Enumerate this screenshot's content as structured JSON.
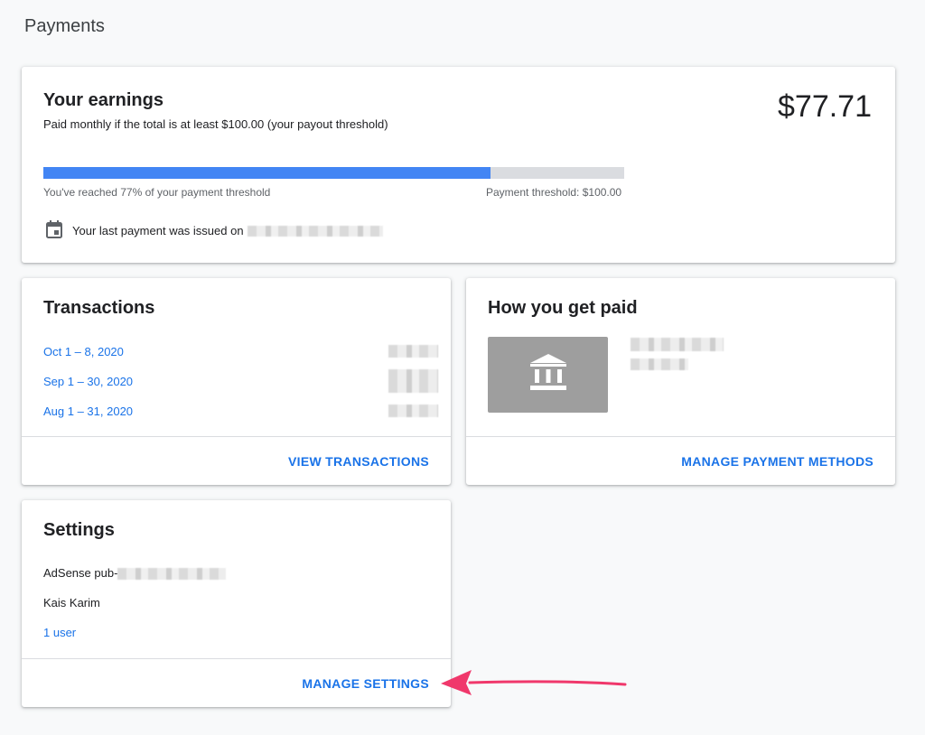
{
  "page": {
    "title": "Payments"
  },
  "earnings": {
    "title": "Your earnings",
    "subtitle": "Paid monthly if the total is at least $100.00 (your payout threshold)",
    "amount": "$77.71",
    "progress_fraction": 0.77,
    "progress_label": "You've reached 77% of your payment threshold",
    "threshold_label": "Payment threshold: $100.00",
    "last_payment_label": "Your last payment was issued on",
    "calendar_icon": "calendar-icon"
  },
  "transactions": {
    "title": "Transactions",
    "items": [
      {
        "period": "Oct 1 – 8, 2020"
      },
      {
        "period": "Sep 1 – 30, 2020"
      },
      {
        "period": "Aug 1 – 31, 2020"
      }
    ],
    "action": "VIEW TRANSACTIONS"
  },
  "payment_method": {
    "title": "How you get paid",
    "icon": "bank-icon",
    "action": "MANAGE PAYMENT METHODS"
  },
  "settings": {
    "title": "Settings",
    "publisher_prefix": "AdSense pub-",
    "name": "Kais Karim",
    "users": "1 user",
    "action": "MANAGE SETTINGS"
  },
  "colors": {
    "accent": "#1a73e8",
    "progress": "#4285f4",
    "arrow": "#f0386b"
  }
}
